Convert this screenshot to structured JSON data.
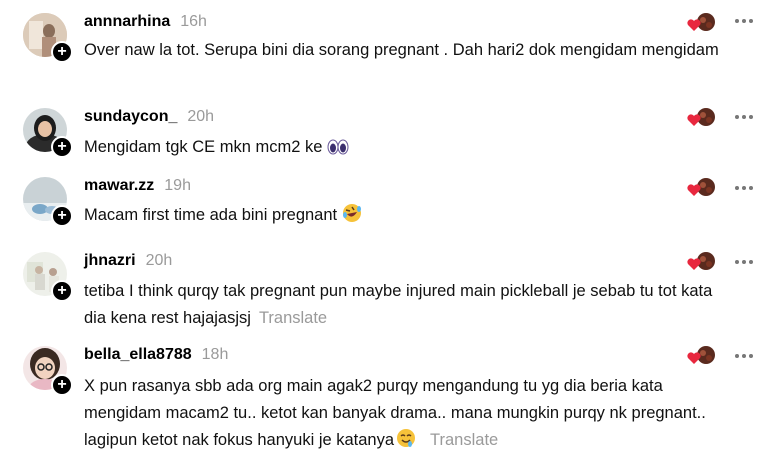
{
  "comments": [
    {
      "username": "annnarhina",
      "time": "16h",
      "text": "Over naw la tot. Serupa bini dia sorang pregnant . Dah hari2 dok mengidam mengidam",
      "emoji": "",
      "translate": ""
    },
    {
      "username": "sundaycon_",
      "time": "20h",
      "text": "Mengidam tgk CE mkn mcm2 ke ",
      "emoji": "eyes-emoji",
      "translate": ""
    },
    {
      "username": "mawar.zz",
      "time": "19h",
      "text": "Macam first time ada bini pregnant ",
      "emoji": "rofl-emoji",
      "translate": ""
    },
    {
      "username": "jhnazri",
      "time": "20h",
      "text": "tetiba I think qurqy tak pregnant pun maybe injured main pickleball je sebab tu tot kata dia kena rest hajajasjsj",
      "emoji": "",
      "translate": "Translate"
    },
    {
      "username": "bella_ella8788",
      "time": "18h",
      "text": "X pun rasanya sbb ada org main agak2 purqy mengandung tu yg dia beria kata mengidam macam2 tu.. ketot kan banyak drama.. mana mungkin purqy nk pregnant.. lagipun ketot nak fokus hanyuki je katanya",
      "emoji": "drooling-emoji",
      "translate": "Translate"
    }
  ],
  "follow_glyph": "+",
  "colors": {
    "heart": "#e8273e",
    "muted": "#9a9a9a"
  }
}
